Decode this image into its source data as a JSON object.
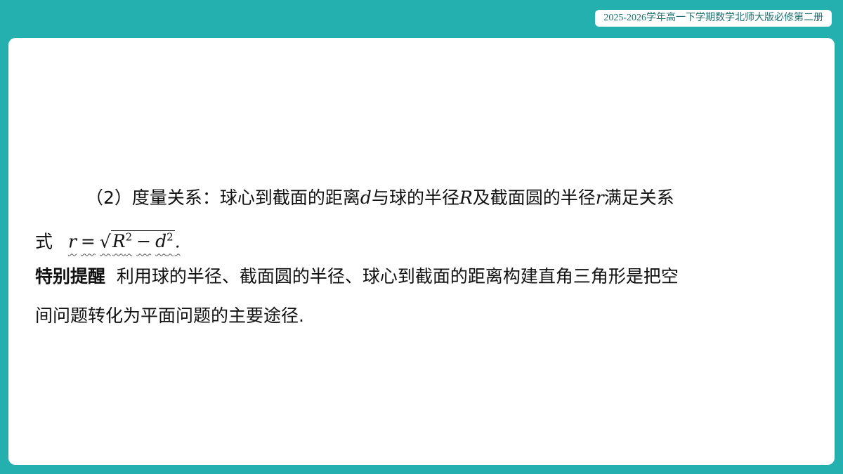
{
  "header": {
    "course_label": "2025-2026学年高一下学期数学北师大版必修第二册"
  },
  "content": {
    "p1_prefix": "（2）度量关系：球心到截面的距离",
    "var_d": "d",
    "p1_mid1": "与球的半径",
    "var_R": "R",
    "p1_mid2": "及截面圆的半径",
    "var_r": "r",
    "p1_suffix": "满足关系",
    "p2_prefix": "式",
    "formula": {
      "lhs": "r",
      "eq": "=",
      "sqrt_symbol": "√",
      "R": "R",
      "exp1": "2",
      "minus": "−",
      "d": "d",
      "exp2": "2",
      "end": "."
    },
    "tip_title": "特别提醒",
    "tip_line1": "利用球的半径、截面圆的半径、球心到截面的距离构建直角三角形是把空",
    "tip_line2": "间问题转化为平面问题的主要途径."
  }
}
